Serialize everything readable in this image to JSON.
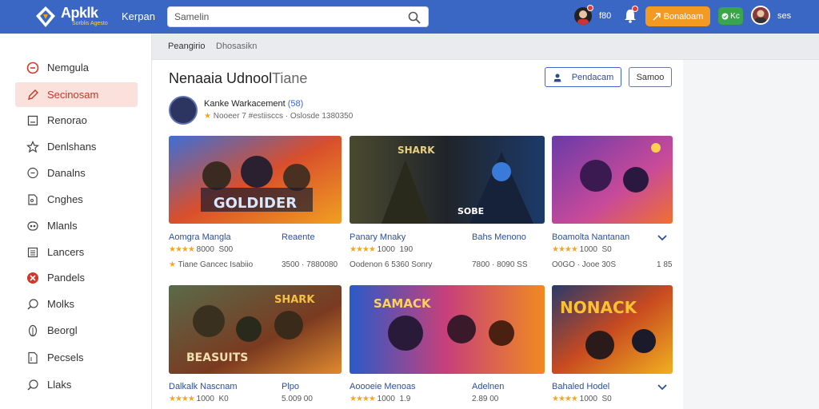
{
  "header": {
    "brand": "Apklk",
    "brand_sub": "Sorblis Agesto",
    "nav_link": "Kerpan",
    "search_placeholder": "Samelin",
    "notif_count": "f80",
    "orange_button": "Bonaloam",
    "green_button": "Kc",
    "user_name": "ses"
  },
  "sidebar": {
    "items": [
      {
        "label": "Nemgula",
        "icon": "circle-minus-icon"
      },
      {
        "label": "Secinosam",
        "icon": "pencil-icon"
      },
      {
        "label": "Renorao",
        "icon": "square-icon"
      },
      {
        "label": "Denlshans",
        "icon": "star-icon"
      },
      {
        "label": "Danalns",
        "icon": "chat-icon"
      },
      {
        "label": "Cnghes",
        "icon": "tag-icon"
      },
      {
        "label": "Mlanls",
        "icon": "link-icon"
      },
      {
        "label": "Lancers",
        "icon": "list-icon"
      },
      {
        "label": "Pandels",
        "icon": "x-circle-icon"
      },
      {
        "label": "Molks",
        "icon": "search-icon"
      },
      {
        "label": "Beorgl",
        "icon": "leaf-icon"
      },
      {
        "label": "Pecsels",
        "icon": "doc-icon"
      },
      {
        "label": "Llaks",
        "icon": "search-icon"
      }
    ]
  },
  "breadcrumb": {
    "first": "Peangirio",
    "second": "Dhosasikn"
  },
  "page": {
    "title": "Nenaaia Udnool",
    "title_light": "Tiane",
    "primary_button": "Pendacam",
    "secondary_button": "Samoo"
  },
  "developer": {
    "name": "Kanke Warkacement",
    "name_suffix": "(58)",
    "meta": "Nooeer 7 #estiisccs · Oslosde 1380350"
  },
  "cards_row1": [
    {
      "title": "Aomgra Mangla",
      "tag": "Reaente",
      "rating": "8000",
      "count": "S00",
      "meta": "Tiane Gancec Isabiio",
      "meta2": "3500 · 7880080"
    },
    {
      "title": "Panary Mnaky",
      "tag": "Bahs Menono",
      "rating": "1000",
      "count": "190",
      "meta": "Oodenon 6 5360 Sonry",
      "meta2": "7800 · 8090 SS"
    },
    {
      "title": "Boamolta Nantanan",
      "tag": "",
      "rating": "1000",
      "count": "S0",
      "meta": "O0GO · Jooe 30S",
      "meta2": "1 85"
    }
  ],
  "cards_row2": [
    {
      "title": "Dalkalk Nascnam",
      "tag": "Plpo",
      "rating": "1000",
      "count": "K0",
      "meta": "5.009 00"
    },
    {
      "title": "Aoooeie Menoas",
      "tag": "Adelnen",
      "rating": "1000",
      "count": "1.9",
      "meta": "2.89 00"
    },
    {
      "title": "Bahaled Hodel",
      "tag": "",
      "rating": "1000",
      "count": "S0",
      "meta": ""
    }
  ],
  "colors": {
    "topbar": "#3a66c4",
    "accent_orange": "#f39a23",
    "accent_green": "#3aa64b",
    "active_item": "#fbe1dc",
    "link_blue": "#2d4f9a"
  }
}
